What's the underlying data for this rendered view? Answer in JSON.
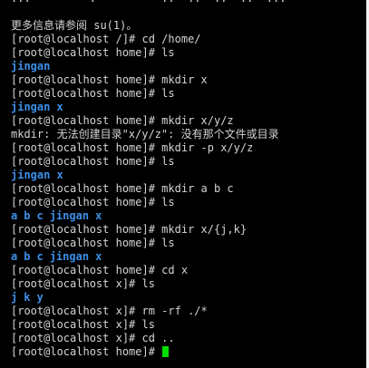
{
  "terminal": {
    "lines": [
      {
        "type": "text",
        "text": "...         .          ..  ..  ..  ..  ..."
      },
      {
        "type": "text",
        "text": ""
      },
      {
        "type": "text",
        "text": "更多信息请参阅 su(1)。"
      },
      {
        "type": "text",
        "text": "[root@localhost /]# cd /home/"
      },
      {
        "type": "text",
        "text": "[root@localhost home]# ls"
      },
      {
        "type": "dirs",
        "items": [
          "jingan"
        ]
      },
      {
        "type": "text",
        "text": "[root@localhost home]# mkdir x"
      },
      {
        "type": "text",
        "text": "[root@localhost home]# ls"
      },
      {
        "type": "dirs",
        "items": [
          "jingan",
          "x"
        ]
      },
      {
        "type": "text",
        "text": "[root@localhost home]# mkdir x/y/z"
      },
      {
        "type": "text",
        "text": "mkdir: 无法创建目录\"x/y/z\": 没有那个文件或目录"
      },
      {
        "type": "text",
        "text": "[root@localhost home]# mkdir -p x/y/z"
      },
      {
        "type": "text",
        "text": "[root@localhost home]# ls"
      },
      {
        "type": "dirs",
        "items": [
          "jingan",
          "x"
        ]
      },
      {
        "type": "text",
        "text": "[root@localhost home]# mkdir a b c"
      },
      {
        "type": "text",
        "text": "[root@localhost home]# ls"
      },
      {
        "type": "dirs",
        "items": [
          "a",
          "b",
          "c",
          "jingan",
          "x"
        ]
      },
      {
        "type": "text",
        "text": "[root@localhost home]# mkdir x/{j,k}"
      },
      {
        "type": "text",
        "text": "[root@localhost home]# ls"
      },
      {
        "type": "dirs",
        "items": [
          "a",
          "b",
          "c",
          "jingan",
          "x"
        ]
      },
      {
        "type": "text",
        "text": "[root@localhost home]# cd x"
      },
      {
        "type": "text",
        "text": "[root@localhost x]# ls"
      },
      {
        "type": "dirs",
        "items": [
          "j",
          "k",
          "y"
        ]
      },
      {
        "type": "text",
        "text": "[root@localhost x]# rm -rf ./*"
      },
      {
        "type": "text",
        "text": "[root@localhost x]# ls"
      },
      {
        "type": "text",
        "text": "[root@localhost x]# cd .."
      },
      {
        "type": "prompt",
        "text": "[root@localhost home]# "
      }
    ]
  },
  "colors": {
    "background": "#000000",
    "text": "#d4d4d4",
    "directory": "#3c8fe8",
    "cursor": "#00e000"
  },
  "icons": {
    "cursor": "block-cursor"
  }
}
